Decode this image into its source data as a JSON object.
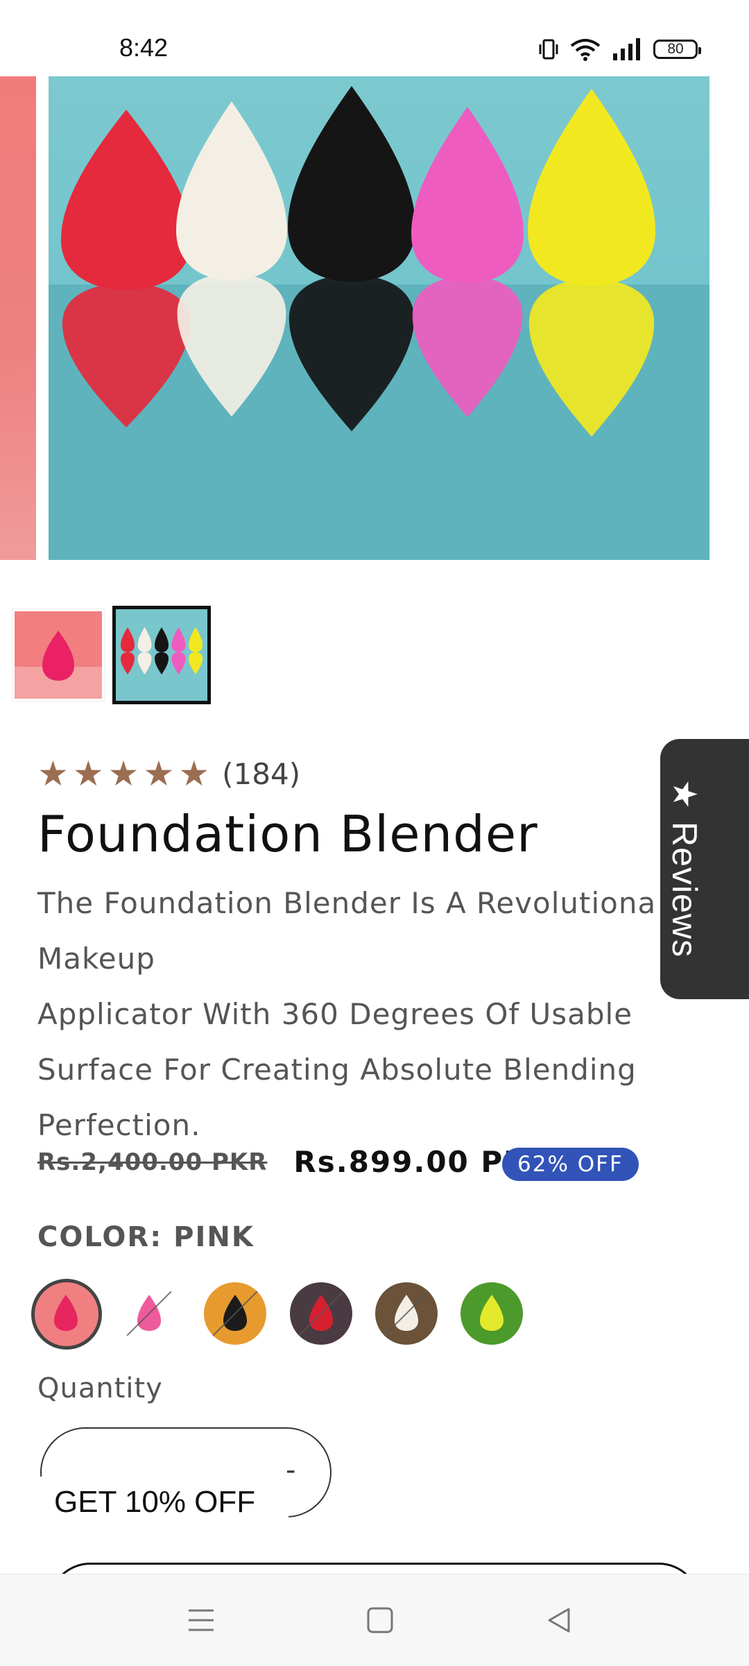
{
  "status_bar": {
    "time": "8:42",
    "battery": "80"
  },
  "product": {
    "rating_count": "(184)",
    "title": "Foundation Blender",
    "description_lines": [
      "The Foundation Blender Is A Revolutiona",
      "Makeup",
      "Applicator With 360 Degrees Of Usable",
      "Surface For Creating Absolute Blending",
      "Perfection."
    ],
    "compare_price": "Rs.2,400.00 PKR",
    "price": "Rs.899.00 PKR",
    "discount": "62% OFF",
    "color_label": "COLOR: PINK",
    "colors": [
      {
        "bg": "#f07f82",
        "drop": "#e6265f",
        "available": true,
        "selected": true
      },
      {
        "bg": "#ffffff",
        "drop": "#ef5a9c",
        "available": false,
        "selected": false
      },
      {
        "bg": "#e79a2e",
        "drop": "#1b1b1b",
        "available": false,
        "selected": false
      },
      {
        "bg": "#4a3a42",
        "drop": "#d6202f",
        "available": false,
        "selected": false
      },
      {
        "bg": "#6b5238",
        "drop": "#f3efe6",
        "available": false,
        "selected": false
      },
      {
        "bg": "#4c9a2c",
        "drop": "#e3ea2b",
        "available": true,
        "selected": false
      }
    ],
    "quantity_label": "Quantity",
    "quantity_minus": "-"
  },
  "reviews_tab": {
    "label": "Reviews"
  },
  "promo": {
    "label": "GET 10% OFF"
  },
  "gallery": {
    "sponge_colors": [
      "#e52a3d",
      "#f3efe4",
      "#151515",
      "#ee5cc0",
      "#f2e820"
    ]
  },
  "nav": {
    "icons": [
      "menu-icon",
      "home-icon",
      "back-icon"
    ]
  }
}
